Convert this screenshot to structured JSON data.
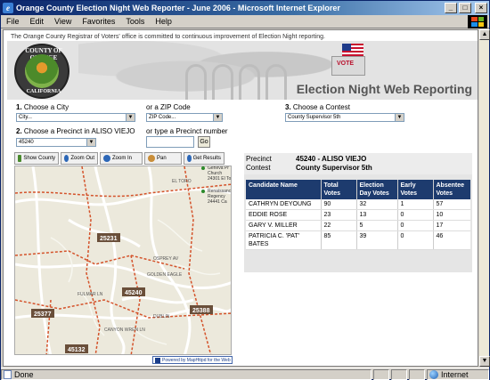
{
  "window": {
    "title": "Orange County Election Night Web Reporter - June 2006 - Microsoft Internet Explorer",
    "menus": [
      "File",
      "Edit",
      "View",
      "Favorites",
      "Tools",
      "Help"
    ]
  },
  "page": {
    "intro": "The Orange County Registrar of Voters' office is committed to continuous improvement of Election Night reporting.",
    "seal_top": "COUNTY OF ORANGE",
    "seal_bottom": "CALIFORNIA",
    "vote_label": "VOTE",
    "banner_title": "Election Night Web Reporting",
    "city_label_num": "1.",
    "city_label": "Choose a City",
    "city_select": "City...",
    "zip_label": "or a ZIP Code",
    "zip_select": "ZIP Code...",
    "contest_label_num": "3.",
    "contest_label": "Choose a Contest",
    "contest_select": "County Supervisor 5th",
    "precinct_label_num": "2.",
    "precinct_label": "Choose a Precinct in ALISO VIEJO",
    "precinct_select": "45240",
    "precinct_type_label": "or type a Precinct number",
    "go_button": "Go"
  },
  "map_tools": [
    {
      "label": "Show County",
      "icon": "county-icon",
      "color": "#4a8a2e"
    },
    {
      "label": "Zoom Out",
      "icon": "zoom-out-icon",
      "color": "#2c67b7"
    },
    {
      "label": "Zoom In",
      "icon": "zoom-in-icon",
      "color": "#2c67b7"
    },
    {
      "label": "Pan",
      "icon": "pan-hand-icon",
      "color": "#c98e3a"
    },
    {
      "label": "Get Results",
      "icon": "info-icon",
      "color": "#2c67b7"
    }
  ],
  "map": {
    "precinct_labels": [
      "25231",
      "45240",
      "25377",
      "25388",
      "45132"
    ],
    "street_labels": [
      "EL TORO",
      "OSPREY AV",
      "GOLDEN EAGLE",
      "DUBLIN",
      "FULMAR LN",
      "CANYON WREN LN"
    ],
    "poi_1": "Geneva Pr Church 24301 El To",
    "poi_2": "Renaissanc Regency 24441 Ca",
    "credit": "Powered by MapHttpd for the Web",
    "colors": {
      "precinct_line": "#d4532b",
      "road": "#ffffff",
      "background": "#ece9dc"
    }
  },
  "info": {
    "precinct_key": "Precinct",
    "precinct_value": "45240 - ALISO VIEJO",
    "contest_key": "Contest",
    "contest_value": "County Supervisor 5th"
  },
  "results": {
    "headers": [
      "Candidate Name",
      "Total Votes",
      "Election Day Votes",
      "Early Votes",
      "Absentee Votes"
    ],
    "rows": [
      [
        "CATHRYN DEYOUNG",
        "90",
        "32",
        "1",
        "57"
      ],
      [
        "EDDIE ROSE",
        "23",
        "13",
        "0",
        "10"
      ],
      [
        "GARY V. MILLER",
        "22",
        "5",
        "0",
        "17"
      ],
      [
        "PATRICIA C. 'PAT' BATES",
        "85",
        "39",
        "0",
        "46"
      ]
    ]
  },
  "status": {
    "left": "Done",
    "zone": "Internet"
  }
}
